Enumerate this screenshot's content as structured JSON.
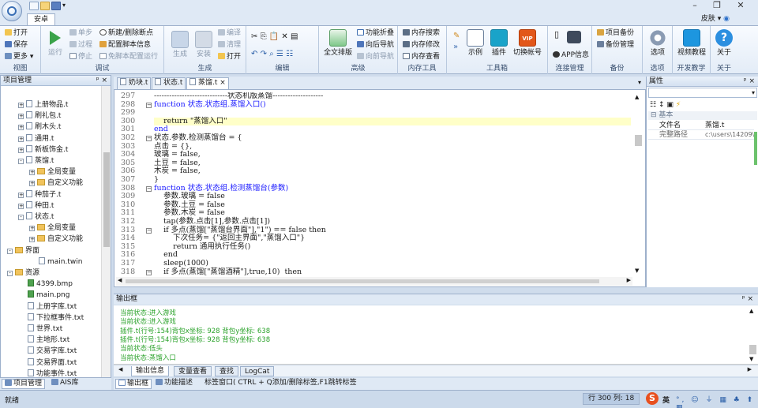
{
  "app": {
    "tab_home": "安卓",
    "skin_label": "皮肤"
  },
  "ribbon": {
    "view": {
      "label": "视图",
      "open": "打开",
      "save": "保存",
      "more": "更多"
    },
    "debug": {
      "label": "调试",
      "run": "运行",
      "step": "单步",
      "process": "过程",
      "stop": "停止",
      "new_breakpoint": "新建/删除断点",
      "config_script": "配置脚本信息",
      "no_config_run": "免脚本配置运行"
    },
    "build": {
      "label": "生成",
      "build": "生成",
      "install": "安装",
      "compile": "编译",
      "clean": "清理",
      "open": "打开"
    },
    "edit": {
      "label": "编辑"
    },
    "advanced": {
      "label": "高级",
      "fulltext": "全文排版",
      "fold": "功能折叠",
      "fwd_nav": "向后导航",
      "back_nav": "向前导航"
    },
    "memory": {
      "label": "内存工具",
      "search": "内存搜索",
      "modify": "内存修改",
      "view": "内存查看"
    },
    "tools": {
      "label": "工具箱",
      "example": "示例",
      "plugin": "插件",
      "switch_account": "切换帐号"
    },
    "connect": {
      "label": "连接管理",
      "app_info": "APP信息"
    },
    "backup": {
      "label": "备份",
      "project_backup": "项目备份",
      "backup_manage": "备份管理"
    },
    "options": {
      "label": "选项",
      "options": "选项"
    },
    "dev": {
      "label": "开发教学",
      "video": "视频教程"
    },
    "about": {
      "label": "关于",
      "about": "关于"
    }
  },
  "project_panel": {
    "title": "项目管理",
    "items": [
      {
        "label": "上册物品.t",
        "type": "file",
        "indent": 1,
        "toggle": "+"
      },
      {
        "label": "刷礼包.t",
        "type": "file",
        "indent": 1,
        "toggle": "+"
      },
      {
        "label": "刷木头.t",
        "type": "file",
        "indent": 1,
        "toggle": "+"
      },
      {
        "label": "通用.t",
        "type": "file",
        "indent": 1,
        "toggle": "+"
      },
      {
        "label": "新板饰金.t",
        "type": "file",
        "indent": 1,
        "toggle": "+"
      },
      {
        "label": "蒸馏.t",
        "type": "file",
        "indent": 1,
        "toggle": "-"
      },
      {
        "label": "全局变量",
        "type": "folder",
        "indent": 2,
        "toggle": "+"
      },
      {
        "label": "自定义功能",
        "type": "folder",
        "indent": 2,
        "toggle": "+"
      },
      {
        "label": "种茄子.t",
        "type": "file",
        "indent": 1,
        "toggle": "+"
      },
      {
        "label": "种田.t",
        "type": "file",
        "indent": 1,
        "toggle": "+"
      },
      {
        "label": "状态.t",
        "type": "file",
        "indent": 1,
        "toggle": "-"
      },
      {
        "label": "全局变量",
        "type": "folder",
        "indent": 2,
        "toggle": "+"
      },
      {
        "label": "自定义功能",
        "type": "folder",
        "indent": 2,
        "toggle": "+"
      },
      {
        "label": "界面",
        "type": "folder",
        "indent": 0,
        "toggle": "-"
      },
      {
        "label": "main.twin",
        "type": "file",
        "indent": 2,
        "toggle": ""
      },
      {
        "label": "资源",
        "type": "folder",
        "indent": 0,
        "toggle": "-"
      },
      {
        "label": "4399.bmp",
        "type": "image",
        "indent": 1,
        "toggle": ""
      },
      {
        "label": "main.png",
        "type": "image",
        "indent": 1,
        "toggle": ""
      },
      {
        "label": "上册字库.txt",
        "type": "file",
        "indent": 1,
        "toggle": ""
      },
      {
        "label": "下拉框事件.txt",
        "type": "file",
        "indent": 1,
        "toggle": ""
      },
      {
        "label": "世界.txt",
        "type": "file",
        "indent": 1,
        "toggle": ""
      },
      {
        "label": "主地形.txt",
        "type": "file",
        "indent": 1,
        "toggle": ""
      },
      {
        "label": "交易字库.txt",
        "type": "file",
        "indent": 1,
        "toggle": ""
      },
      {
        "label": "交易界面.txt",
        "type": "file",
        "indent": 1,
        "toggle": ""
      },
      {
        "label": "功能事件.txt",
        "type": "file",
        "indent": 1,
        "toggle": ""
      },
      {
        "label": "多选框事件.txt",
        "type": "file",
        "indent": 1,
        "toggle": ""
      }
    ]
  },
  "left_tabs": {
    "project": "项目管理",
    "ais": "AIS库"
  },
  "editor": {
    "tabs": [
      "奶块.t",
      "状态.t",
      "蒸馏.t"
    ],
    "lines": [
      {
        "n": "297",
        "t": "-----------------------------状态机版蒸馏--------------------"
      },
      {
        "n": "298",
        "t": "function 状态.状态组.蒸馏入口()",
        "kw": true,
        "fold": true
      },
      {
        "n": "299",
        "t": ""
      },
      {
        "n": "300",
        "t": "    return \"蒸馏入口\"",
        "cur": true
      },
      {
        "n": "301",
        "t": "end",
        "kw": true
      },
      {
        "n": "302",
        "t": "状态.参数.检测蒸馏台 = {",
        "fold": true
      },
      {
        "n": "303",
        "t": "点击 = {},"
      },
      {
        "n": "304",
        "t": "玻璃 = false,"
      },
      {
        "n": "305",
        "t": "土豆 = false,"
      },
      {
        "n": "306",
        "t": "木炭 = false,"
      },
      {
        "n": "307",
        "t": "}"
      },
      {
        "n": "308",
        "t": "function 状态.状态组.检测蒸馏台(参数)",
        "kw": true,
        "fold": true
      },
      {
        "n": "309",
        "t": "    参数.玻璃 = false"
      },
      {
        "n": "310",
        "t": "    参数.土豆 = false"
      },
      {
        "n": "311",
        "t": "    参数.木炭 = false"
      },
      {
        "n": "312",
        "t": "    tap(参数.点击[1],参数.点击[1])"
      },
      {
        "n": "313",
        "t": "    if 多点(蒸馏[\"蒸馏台界面\"],\"1\") == false then",
        "fold": true
      },
      {
        "n": "314",
        "t": "        下次任务= {\"返回主界面\",\"蒸馏入口\"}"
      },
      {
        "n": "315",
        "t": "        return 通用执行任务()"
      },
      {
        "n": "316",
        "t": "    end"
      },
      {
        "n": "317",
        "t": "    sleep(1000)"
      },
      {
        "n": "318",
        "t": "    if 多点(蒸馏[\"蒸馏酒精\"],true,10)  then",
        "fold": true
      }
    ]
  },
  "properties": {
    "title": "属性",
    "category": "基本",
    "rows": [
      {
        "key": "文件名",
        "value": "蒸馏.t"
      },
      {
        "key": "完整路径",
        "value": "c:\\users\\14209\\"
      }
    ]
  },
  "output": {
    "title": "输出框",
    "lines": [
      "当前状态:进入游戏",
      "当前状态:进入游戏",
      "插件.t(行号:154)背包x坐标: 928 背包y坐标: 638",
      "插件.t(行号:154)背包x坐标: 928 背包y坐标: 638",
      "当前状态:低头",
      "当前状态:蒸馏入口"
    ],
    "tabs": [
      "输出信息",
      "变量查看",
      "查找",
      "LogCat"
    ]
  },
  "bottom_bar": {
    "output": "输出框",
    "func_desc": "功能描述",
    "tag_window": "标签窗口( CTRL + Q添加/删除标签,F1跳转标签"
  },
  "status": {
    "ready": "就绪",
    "position": "行 300  列: 18",
    "ime": "英"
  }
}
